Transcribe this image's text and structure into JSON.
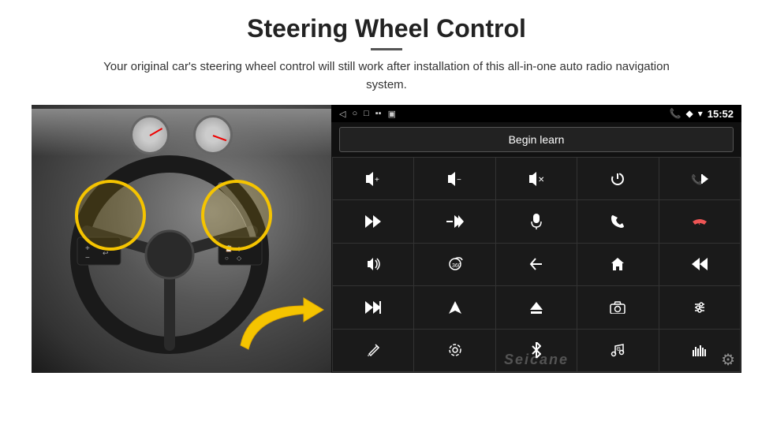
{
  "header": {
    "title": "Steering Wheel Control",
    "subtitle": "Your original car's steering wheel control will still work after installation of this all-in-one auto radio navigation system."
  },
  "statusbar": {
    "time": "15:52",
    "back_icon": "◁",
    "home_icon": "○",
    "recents_icon": "□",
    "signal_icon": "▪▪▪",
    "phone_icon": "📞",
    "location_icon": "◆",
    "wifi_icon": "▼"
  },
  "begin_learn_label": "Begin learn",
  "grid_buttons": [
    {
      "icon": "🔊+",
      "label": "vol-up"
    },
    {
      "icon": "🔊−",
      "label": "vol-down"
    },
    {
      "icon": "🔇",
      "label": "mute"
    },
    {
      "icon": "⏻",
      "label": "power"
    },
    {
      "icon": "📞⏮",
      "label": "phone-prev"
    },
    {
      "icon": "⏭",
      "label": "next-track"
    },
    {
      "icon": "✂⏭",
      "label": "skip"
    },
    {
      "icon": "🎤",
      "label": "mic"
    },
    {
      "icon": "📞",
      "label": "phone"
    },
    {
      "icon": "↩",
      "label": "hang-up"
    },
    {
      "icon": "📢",
      "label": "horn"
    },
    {
      "icon": "360",
      "label": "camera-360"
    },
    {
      "icon": "↩",
      "label": "back"
    },
    {
      "icon": "⌂",
      "label": "home"
    },
    {
      "icon": "⏮⏮",
      "label": "prev-track"
    },
    {
      "icon": "⏭⏭",
      "label": "fast-forward"
    },
    {
      "icon": "▶",
      "label": "play"
    },
    {
      "icon": "⊖",
      "label": "eject"
    },
    {
      "icon": "📷",
      "label": "camera"
    },
    {
      "icon": "⚙",
      "label": "equalizer"
    },
    {
      "icon": "✏",
      "label": "edit"
    },
    {
      "icon": "⊙",
      "label": "settings"
    },
    {
      "icon": "✶",
      "label": "bluetooth"
    },
    {
      "icon": "♫",
      "label": "music"
    },
    {
      "icon": "▌▌▌",
      "label": "spectrum"
    }
  ],
  "watermark": "Seicane",
  "gear_icon": "⚙"
}
